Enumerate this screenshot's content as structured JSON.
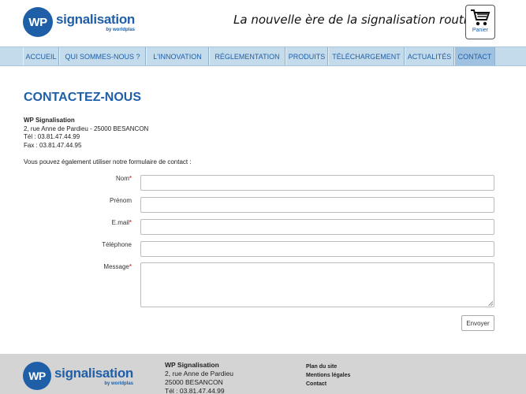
{
  "brand": {
    "logo_initials": "WP",
    "logo_name": "signalisation",
    "logo_sub": "by worldplas",
    "tagline": "La nouvelle ère de la signalisation routière",
    "cart_label": "Panier",
    "accent": "#1f5fa8"
  },
  "nav": {
    "items": [
      {
        "label": "ACCUEIL"
      },
      {
        "label": "QUI SOMMES-NOUS ?"
      },
      {
        "label": "L'INNOVATION"
      },
      {
        "label": "RÉGLEMENTATION"
      },
      {
        "label": "PRODUITS"
      },
      {
        "label": "TÉLÉCHARGEMENT"
      },
      {
        "label": "ACTUALITÉS"
      },
      {
        "label": "CONTACT"
      }
    ],
    "active": "CONTACT"
  },
  "main": {
    "title": "CONTACTEZ-NOUS",
    "company": "WP Signalisation",
    "address": "2, rue Anne de Pardieu - 25000 BESANCON",
    "phone": "Tél : 03.81.47.44.99",
    "fax": "Fax : 03.81.47.44.95",
    "intro": "Vous pouvez également utiliser notre formulaire de contact :"
  },
  "form": {
    "fields": [
      {
        "label": "Nom",
        "required": "*",
        "value": ""
      },
      {
        "label": "Prénom",
        "required": "",
        "value": ""
      },
      {
        "label": "E.mail",
        "required": "*",
        "value": ""
      },
      {
        "label": "Téléphone",
        "required": "",
        "value": ""
      },
      {
        "label": "Message",
        "required": "*",
        "value": ""
      }
    ],
    "submit_label": "Envoyer"
  },
  "footer": {
    "company": "WP Signalisation",
    "street": "2, rue Anne de Pardieu",
    "city": "25000 BESANCON",
    "phone": "Tél : 03.81.47.44.99",
    "links": [
      "Plan du site",
      "Mentions légales",
      "Contact"
    ]
  }
}
